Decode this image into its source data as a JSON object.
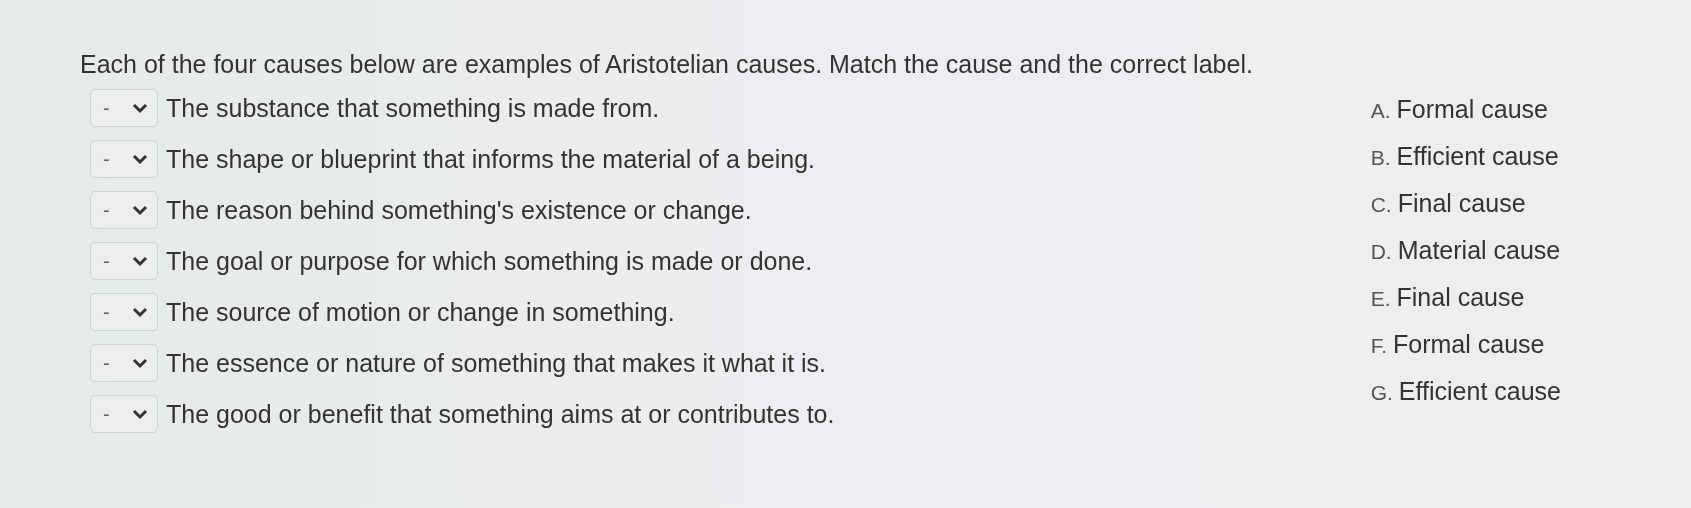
{
  "prompt": "Each of the four causes below are examples of Aristotelian causes. Match the cause and the correct label.",
  "items": [
    {
      "dropdown": "-",
      "text": "The substance that something is made from."
    },
    {
      "dropdown": "-",
      "text": "The shape or blueprint that informs the material of a being."
    },
    {
      "dropdown": "-",
      "text": "The reason behind something's existence or change."
    },
    {
      "dropdown": "-",
      "text": "The goal or purpose for which something is made or done."
    },
    {
      "dropdown": "-",
      "text": "The source of motion or change in something."
    },
    {
      "dropdown": "-",
      "text": "The essence or nature of something that makes it what it is."
    },
    {
      "dropdown": "-",
      "text": "The good or benefit that something aims at or contributes to."
    }
  ],
  "labels": [
    {
      "letter": "A.",
      "text": "Formal cause"
    },
    {
      "letter": "B.",
      "text": "Efficient cause"
    },
    {
      "letter": "C.",
      "text": "Final cause"
    },
    {
      "letter": "D.",
      "text": "Material cause"
    },
    {
      "letter": "E.",
      "text": "Final cause"
    },
    {
      "letter": "F.",
      "text": "Formal cause"
    },
    {
      "letter": "G.",
      "text": "Efficient cause"
    }
  ]
}
